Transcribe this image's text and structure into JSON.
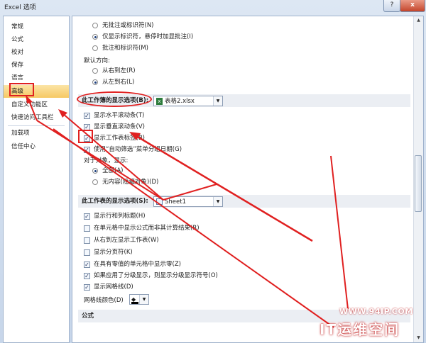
{
  "window": {
    "title": "Excel 选项",
    "help_glyph": "?",
    "close_glyph": "x"
  },
  "sidebar": {
    "items": [
      {
        "label": "常规"
      },
      {
        "label": "公式"
      },
      {
        "label": "校对"
      },
      {
        "label": "保存"
      },
      {
        "label": "语言"
      },
      {
        "label": "高级"
      },
      {
        "label": "自定义功能区"
      },
      {
        "label": "快速访问工具栏"
      },
      {
        "label": "加载项"
      },
      {
        "label": "信任中心"
      }
    ],
    "active_index": 5
  },
  "comments": {
    "none": "无批注或标识符(N)",
    "indicator_only": "仅显示标识符，悬停时加显批注(I)",
    "both": "批注和标识符(M)",
    "selected": "indicator_only"
  },
  "direction": {
    "label": "默认方向:",
    "rtl": "从右到左(R)",
    "ltr": "从左到右(L)",
    "selected": "ltr"
  },
  "workbook_section": {
    "header": "此工作簿的显示选项(B):",
    "workbook_value": "表格2.xlsx",
    "h_scroll": "显示水平滚动条(T)",
    "v_scroll": "显示垂直滚动条(V)",
    "sheet_tabs": "显示工作表标签(B)",
    "autofilter": "使用“自动筛选”菜单分组日期(G)",
    "objects_label": "对于对象，显示:",
    "obj_all": "全部(A)",
    "obj_none": "无内容(隐藏对象)(D)",
    "checked": {
      "h_scroll": true,
      "v_scroll": true,
      "sheet_tabs": true,
      "autofilter": true
    },
    "objects_selected": "all"
  },
  "worksheet_section": {
    "header": "此工作表的显示选项(S):",
    "sheet_value": "Sheet1",
    "items": [
      {
        "label": "显示行和列标题(H)",
        "checked": true
      },
      {
        "label": "在单元格中显示公式而非其计算结果(R)",
        "checked": false
      },
      {
        "label": "从右到左显示工作表(W)",
        "checked": false
      },
      {
        "label": "显示分页符(K)",
        "checked": false
      },
      {
        "label": "在具有零值的单元格中显示零(Z)",
        "checked": true
      },
      {
        "label": "如果应用了分级显示，则显示分级显示符号(O)",
        "checked": true
      },
      {
        "label": "显示网格线(D)",
        "checked": true
      }
    ],
    "gridline_label": "网格线颜色(D)"
  },
  "formula_section": {
    "header": "公式"
  },
  "watermark": {
    "url": "WWW.94IP.COM",
    "name": "IT运维空间"
  },
  "colors": {
    "annotation": "#e02020",
    "active_item": "#f6c964"
  }
}
